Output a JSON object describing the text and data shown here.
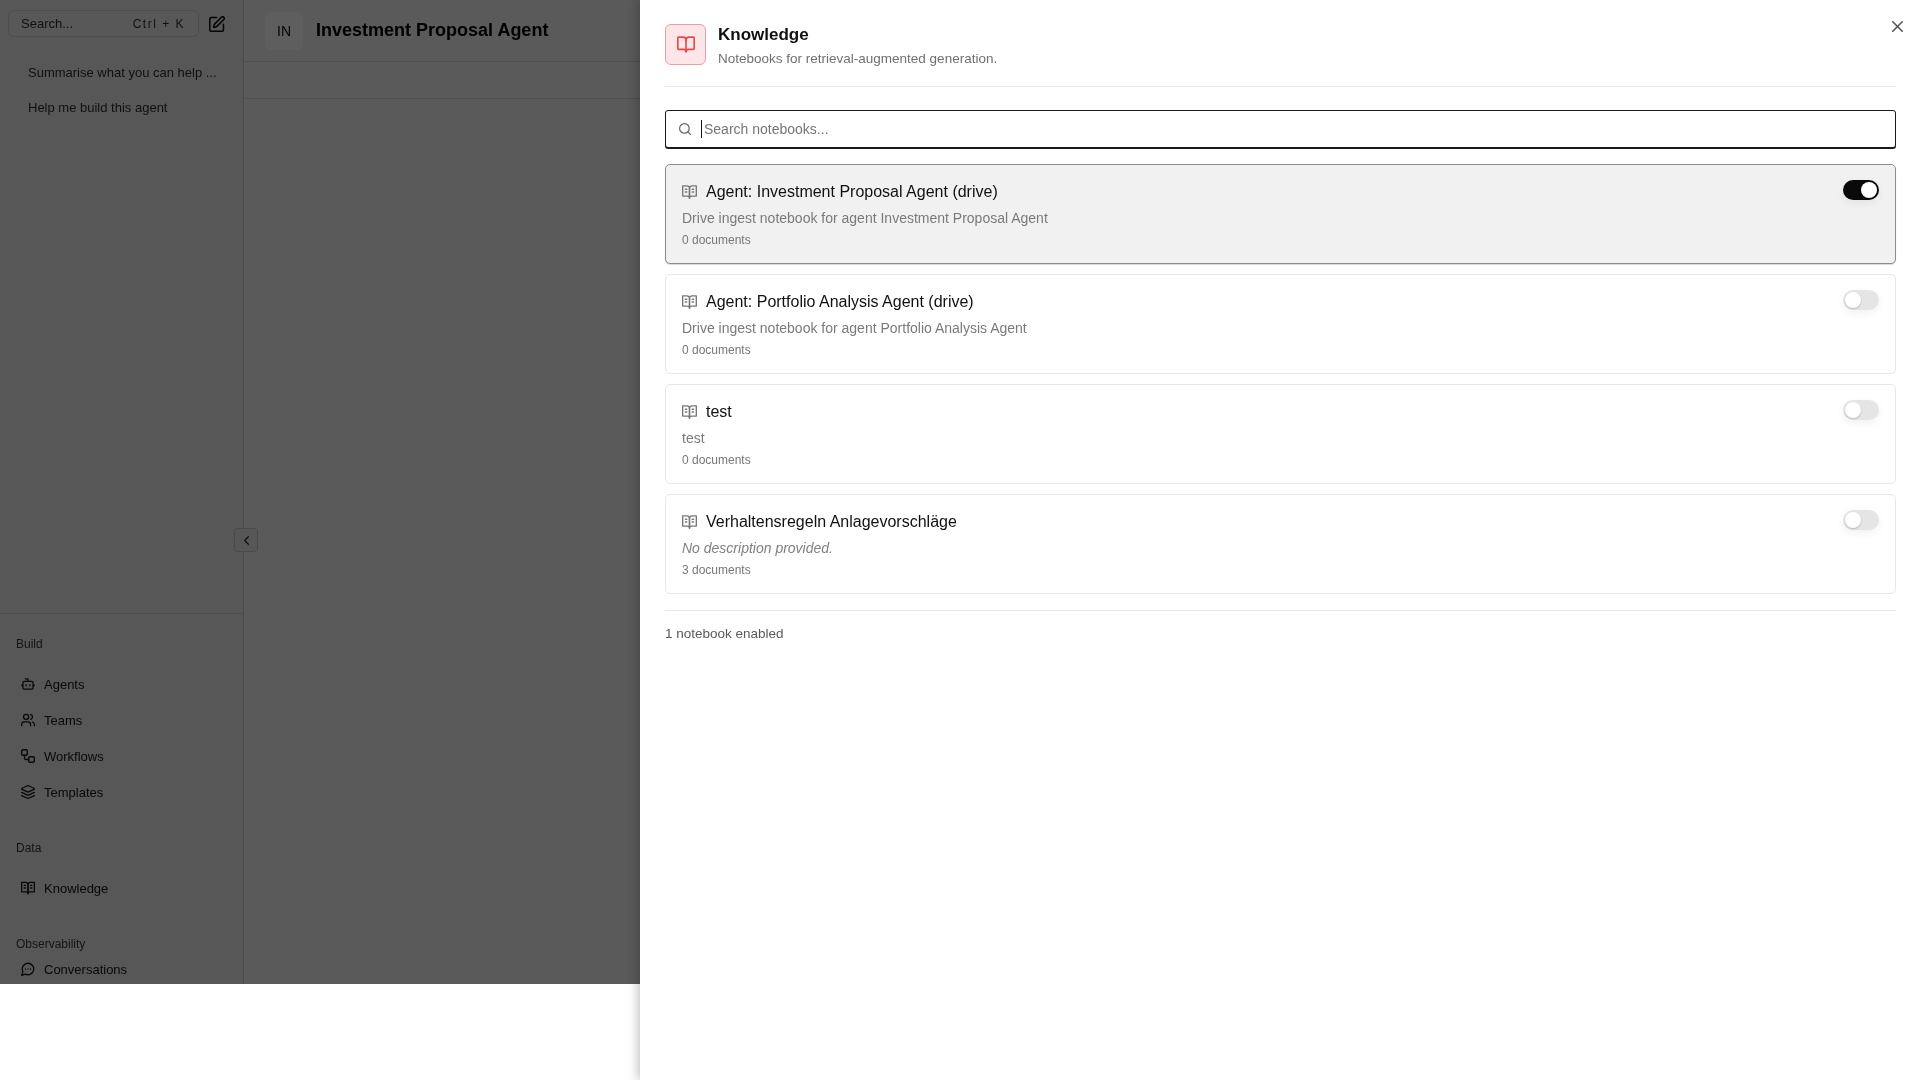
{
  "sidebar": {
    "search": {
      "placeholder": "Search...",
      "shortcut": "Ctrl + K"
    },
    "chats": [
      {
        "title": "Summarise what you can help ..."
      },
      {
        "title": "Help me build this agent"
      }
    ],
    "sections": [
      {
        "title": "Build",
        "items": [
          {
            "label": "Agents"
          },
          {
            "label": "Teams"
          },
          {
            "label": "Workflows"
          },
          {
            "label": "Templates"
          }
        ]
      },
      {
        "title": "Data",
        "items": [
          {
            "label": "Knowledge"
          }
        ]
      },
      {
        "title": "Observability",
        "items": [
          {
            "label": "Conversations"
          }
        ]
      }
    ]
  },
  "header": {
    "avatar": "IN",
    "title": "Investment Proposal Agent"
  },
  "panel": {
    "title": "Knowledge",
    "subtitle": "Notebooks for retrieval-augmented generation.",
    "search": {
      "placeholder": "Search notebooks...",
      "focused": true
    },
    "notebooks": [
      {
        "title": "Agent: Investment Proposal Agent (drive)",
        "description": "Drive ingest notebook for agent Investment Proposal Agent",
        "has_description": true,
        "documents": "0 documents",
        "enabled": true
      },
      {
        "title": "Agent: Portfolio Analysis Agent (drive)",
        "description": "Drive ingest notebook for agent Portfolio Analysis Agent",
        "has_description": true,
        "documents": "0 documents",
        "enabled": false
      },
      {
        "title": "test",
        "description": "test",
        "has_description": true,
        "documents": "0 documents",
        "enabled": false
      },
      {
        "title": "Verhaltensregeln Anlagevorschläge",
        "description": "No description provided.",
        "has_description": false,
        "documents": "3 documents",
        "enabled": false
      }
    ],
    "footer": "1 notebook enabled"
  }
}
